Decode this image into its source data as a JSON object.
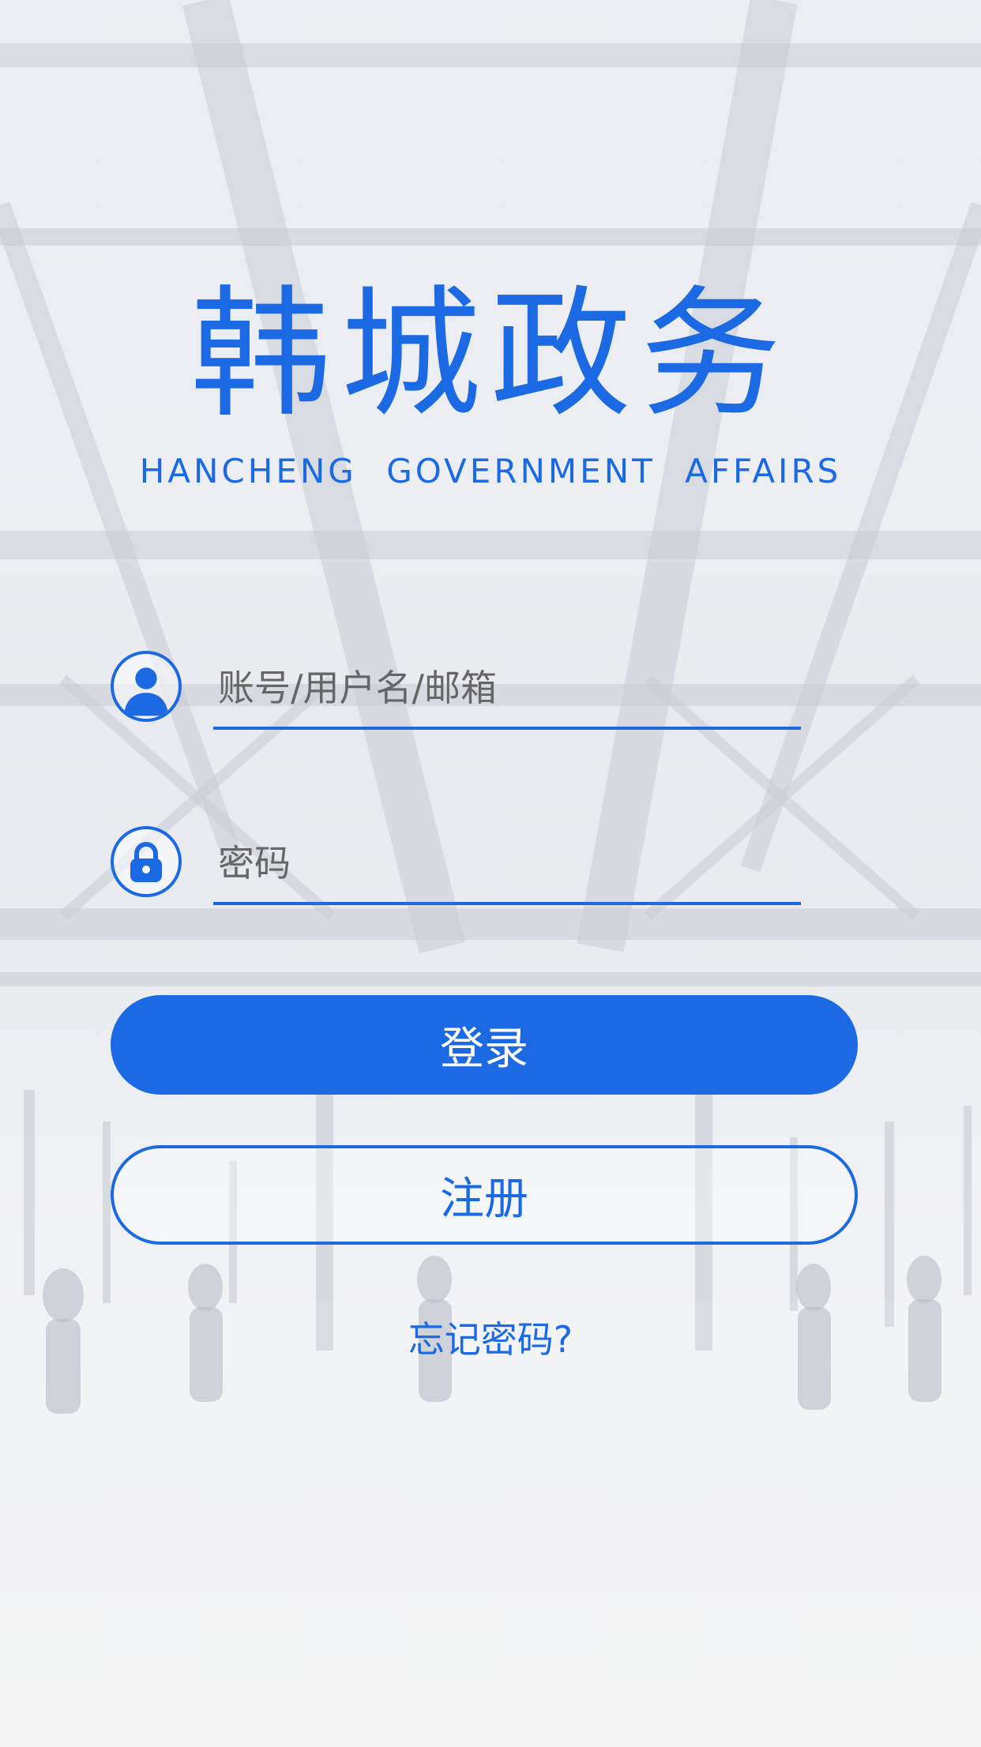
{
  "app": {
    "title": "韩城政务",
    "subtitle": "HANCHENG GOVERNMENT AFFAIRS"
  },
  "form": {
    "username_placeholder": "账号/用户名/邮箱",
    "username_icon": "user-icon",
    "password_placeholder": "密码",
    "password_icon": "lock-icon"
  },
  "actions": {
    "login_label": "登录",
    "register_label": "注册",
    "forgot_label": "忘记密码?"
  },
  "colors": {
    "accent": "#1b6ae4",
    "button_text": "#ffffff"
  }
}
